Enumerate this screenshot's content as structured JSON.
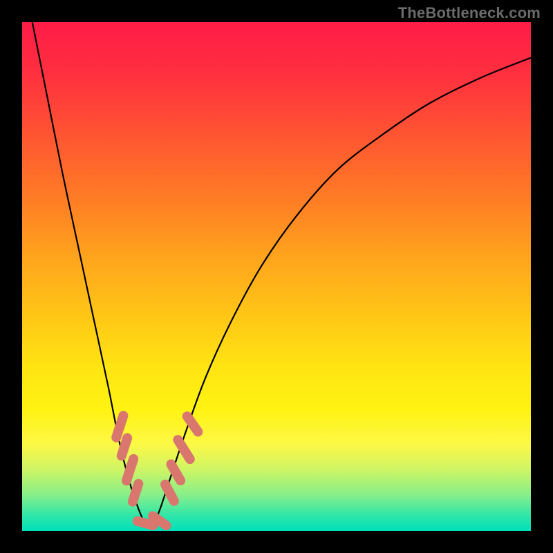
{
  "watermark": "TheBottleneck.com",
  "chart_data": {
    "type": "line",
    "title": "",
    "xlabel": "",
    "ylabel": "",
    "xlim": [
      0,
      100
    ],
    "ylim": [
      0,
      100
    ],
    "grid": false,
    "legend": false,
    "series": [
      {
        "name": "bottleneck-curve",
        "x": [
          2,
          5,
          8,
          11,
          14,
          17,
          19,
          21,
          23,
          24.5,
          25.5,
          27,
          29,
          32,
          36,
          41,
          47,
          54,
          62,
          71,
          80,
          90,
          100
        ],
        "y": [
          100,
          85,
          70,
          56,
          42,
          28,
          18,
          10,
          4,
          1,
          1,
          4,
          10,
          19,
          30,
          41,
          52,
          62,
          71,
          78,
          84,
          89,
          93
        ]
      }
    ],
    "markers": [
      {
        "name": "left-marker-1",
        "x": 19.2,
        "y": 20.5,
        "len": 4,
        "angle": -72
      },
      {
        "name": "left-marker-2",
        "x": 20.1,
        "y": 16.5,
        "len": 3.5,
        "angle": -72
      },
      {
        "name": "left-marker-3",
        "x": 21.2,
        "y": 12.0,
        "len": 4,
        "angle": -72
      },
      {
        "name": "left-marker-4",
        "x": 22.3,
        "y": 7.5,
        "len": 3.5,
        "angle": -72
      },
      {
        "name": "bottom-marker-1",
        "x": 24.2,
        "y": 1.5,
        "len": 3.2,
        "angle": 15
      },
      {
        "name": "bottom-marker-2",
        "x": 27.0,
        "y": 2.0,
        "len": 3.2,
        "angle": 35
      },
      {
        "name": "right-marker-1",
        "x": 29.0,
        "y": 7.5,
        "len": 3.5,
        "angle": 62
      },
      {
        "name": "right-marker-2",
        "x": 30.2,
        "y": 11.5,
        "len": 3.5,
        "angle": 60
      },
      {
        "name": "right-marker-3",
        "x": 31.8,
        "y": 16.0,
        "len": 4,
        "angle": 58
      },
      {
        "name": "right-marker-4",
        "x": 33.5,
        "y": 21.0,
        "len": 3.5,
        "angle": 55
      }
    ],
    "colors": {
      "curve": "#000000",
      "marker_fill": "#d9776f",
      "gradient_top": "#ff1c47",
      "gradient_bottom": "#00e0b9"
    }
  }
}
